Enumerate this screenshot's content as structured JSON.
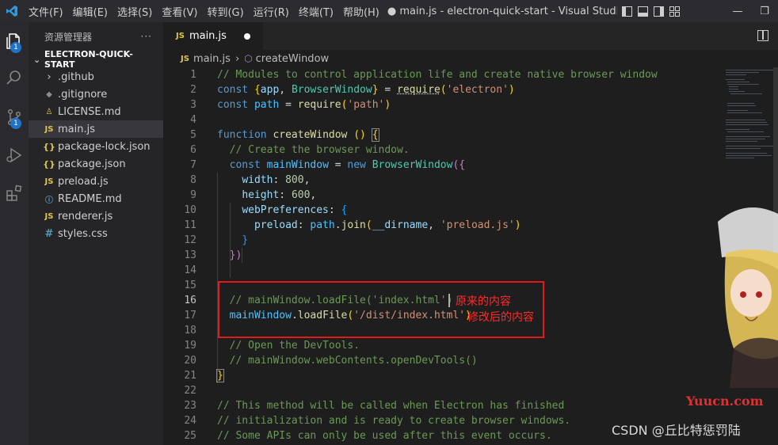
{
  "titlebar": {
    "menu": [
      "文件(F)",
      "编辑(E)",
      "选择(S)",
      "查看(V)",
      "转到(G)",
      "运行(R)",
      "终端(T)",
      "帮助(H)"
    ],
    "title": "● main.js - electron-quick-start - Visual Studio Code [..."
  },
  "activitybar": {
    "badge_explorer": "1",
    "badge_scm": "1"
  },
  "sidebar": {
    "header": "资源管理器",
    "more": "···",
    "project": "ELECTRON-QUICK-START",
    "files": [
      {
        "name": ".github",
        "type": "folder",
        "icon": "chevron-right-icon"
      },
      {
        "name": ".gitignore",
        "type": "git",
        "icon": "git-icon"
      },
      {
        "name": "LICENSE.md",
        "type": "license",
        "icon": "license-icon"
      },
      {
        "name": "main.js",
        "type": "js",
        "icon": "js-icon"
      },
      {
        "name": "package-lock.json",
        "type": "json",
        "icon": "json-icon"
      },
      {
        "name": "package.json",
        "type": "json",
        "icon": "json-icon"
      },
      {
        "name": "preload.js",
        "type": "js",
        "icon": "js-icon"
      },
      {
        "name": "README.md",
        "type": "md",
        "icon": "info-icon"
      },
      {
        "name": "renderer.js",
        "type": "js",
        "icon": "js-icon"
      },
      {
        "name": "styles.css",
        "type": "css",
        "icon": "hash-icon"
      }
    ]
  },
  "editor": {
    "tab_label": "main.js",
    "file_badge": "JS",
    "breadcrumb_file": "main.js",
    "breadcrumb_symbol": "createWindow",
    "line_numbers": [
      "1",
      "2",
      "3",
      "4",
      "5",
      "6",
      "7",
      "8",
      "9",
      "10",
      "11",
      "12",
      "13",
      "14",
      "15",
      "16",
      "17",
      "18",
      "19",
      "20",
      "21",
      "22",
      "23",
      "24",
      "25"
    ],
    "current_line": "16"
  },
  "code": {
    "l1": "// Modules to control application life and create native browser window",
    "l2_kw": "const",
    "l2_b1": "{",
    "l2_v1": "app",
    "l2_comma": ",",
    "l2_v2": "BrowserWindow",
    "l2_b2": "}",
    "l2_eq": "=",
    "l2_fn": "require",
    "l2_str": "'electron'",
    "l3_kw": "const",
    "l3_v": "path",
    "l3_eq": "=",
    "l3_fn": "require",
    "l3_str": "'path'",
    "l5_kw": "function",
    "l5_fn": "createWindow",
    "l5_par": "()",
    "l5_b": "{",
    "l6": "// Create the browser window.",
    "l7_kw": "const",
    "l7_v": "mainWindow",
    "l7_eq": "=",
    "l7_new": "new",
    "l7_cls": "BrowserWindow",
    "l7_b": "({",
    "l8_k": "width",
    "l8_v": "800",
    "l9_k": "height",
    "l9_v": "600",
    "l10_k": "webPreferences",
    "l10_b": "{",
    "l11_k": "preload",
    "l11_obj": "path",
    "l11_fn": "join",
    "l11_dn": "__dirname",
    "l11_str": "'preload.js'",
    "l12_b": "}",
    "l13_b": "})",
    "l16_com": "// mainWindow.loadFile('index.html')",
    "l17_obj": "mainWindow",
    "l17_fn": "loadFile",
    "l17_str": "'/dist/index.html'",
    "l19": "// Open the DevTools.",
    "l20": "// mainWindow.webContents.openDevTools()",
    "l21_b": "}",
    "l23": "// This method will be called when Electron has finished",
    "l24": "// initialization and is ready to create browser windows.",
    "l25": "// Some APIs can only be used after this event occurs."
  },
  "annotations": {
    "original": "原来的内容",
    "modified": "修改后的内容"
  },
  "watermarks": {
    "yuucn": "Yuucn.com",
    "csdn": "CSDN @丘比特惩罚陆"
  },
  "colors": {
    "accent_badge": "#1d73c9",
    "annotation_red": "#e11b1b"
  }
}
